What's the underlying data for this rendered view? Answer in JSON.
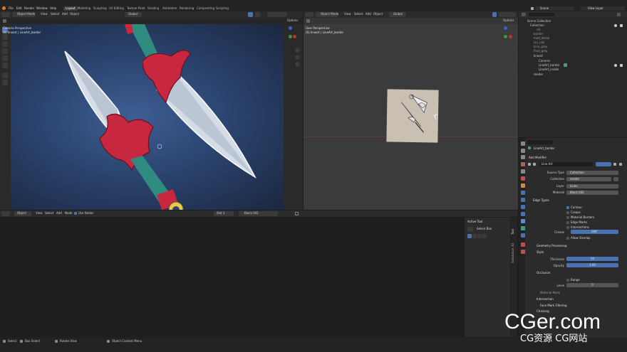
{
  "topbar": {
    "menus": [
      "File",
      "Edit",
      "Render",
      "Window",
      "Help"
    ],
    "workspaces": [
      "Layout",
      "Modeling",
      "Sculpting",
      "UV Editing",
      "Texture Paint",
      "Shading",
      "Animation",
      "Rendering",
      "Compositing",
      "Scripting"
    ],
    "active_workspace": "Layout",
    "scene": "Scene",
    "view_layer": "View Layer"
  },
  "left_viewport": {
    "mode": "Object Mode",
    "menus": [
      "View",
      "Select",
      "Add",
      "Object"
    ],
    "transform": "Global",
    "options": "Options",
    "overlay_line1": "Camera Perspective",
    "overlay_line2": "(6) lineart | LineArt_border"
  },
  "mid_viewport": {
    "mode": "Object Mode",
    "menus": [
      "View",
      "Select",
      "Add",
      "Object"
    ],
    "transform": "Global",
    "options": "Options",
    "overlay_line1": "User Perspective",
    "overlay_line2": "(6) lineart | LineArt_border"
  },
  "bottom_editor": {
    "mode": "Object",
    "menus": [
      "View",
      "Select",
      "Add",
      "Node"
    ],
    "use_nodes": "Use Nodes",
    "slot": "Slot 1",
    "material": "Black.002"
  },
  "active_tool_panel": {
    "title": "Active Tool",
    "tool": "Select Box",
    "tabs": [
      "Tool",
      "Substance 3D"
    ]
  },
  "outliner": {
    "rows": [
      "Scene Collection",
      "Collection",
      "rot",
      "border",
      "mod_detail",
      "Lin_Lab",
      "Line_grey",
      "final_grey",
      "lineart",
      "Camera",
      "LineArt_border",
      "LineArt_inside",
      "render"
    ]
  },
  "properties": {
    "object_name": "LineArt_border",
    "add_modifier": "Add Modifier",
    "modifier_name": "Line Art",
    "source_type_label": "Source Type",
    "source_type": "Collection",
    "collection_label": "Collection",
    "collection": "render",
    "layer_label": "Layer",
    "layer": "Lines",
    "material_label": "Material",
    "material": "Black.002",
    "edge_types": "Edge Types",
    "edge_items": [
      "Contour",
      "Crease",
      "Material Borders",
      "Edge Marks",
      "Intersections"
    ],
    "edge_checked": [
      true,
      false,
      false,
      false,
      false
    ],
    "crease_label": "Crease",
    "crease_value": "180°",
    "allow_overlap": "Allow Overlap",
    "geometry_processing": "Geometry Processing",
    "style": "Style",
    "thickness_label": "Thickness",
    "thickness_value": "50",
    "opacity_label": "Opacity",
    "opacity_value": "1.00",
    "occlusion": "Occlusion",
    "range_label": "Range",
    "level_label": "Level",
    "level_value": "0",
    "material_mask": "Material Mask",
    "intersection": "Intersection",
    "face_mark": "Face Mark Filtering",
    "chaining": "Chaining"
  },
  "statusbar": {
    "items": [
      "Select",
      "Box Select",
      "Rotate View",
      "Object Context Menu"
    ]
  },
  "watermark": {
    "main": "CGer.com",
    "sub": "CG资源 CG网站"
  },
  "colors": {
    "accent": "#4772b3",
    "blade_red": "#c8283f",
    "handle_teal": "#2f8a80"
  }
}
